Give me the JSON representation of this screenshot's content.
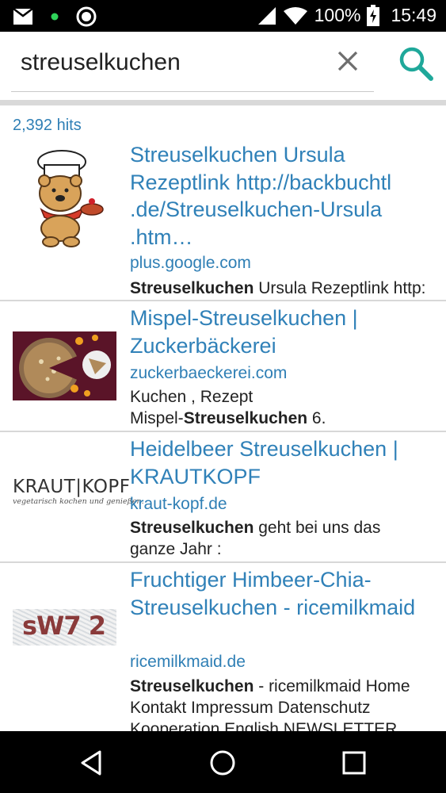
{
  "status_bar": {
    "battery_percent": "100%",
    "time": "15:49",
    "icons": [
      "mail-icon",
      "notification-dot-icon",
      "record-icon",
      "signal-icon",
      "wifi-icon",
      "battery-charging-icon"
    ]
  },
  "search": {
    "query": "streuselkuchen",
    "clear_icon": "close-icon",
    "search_icon": "search-icon"
  },
  "results_count": "2,392 hits",
  "results": [
    {
      "title": "Streuselkuchen Ursula Rezeptlink http://backbuchtl .de/Streuselkuchen-Ursula .htm…",
      "domain": "plus.google.com",
      "snippet_lines": [
        {
          "bold": "Streuselkuchen",
          "text": " Ursula Rezeptlink http:"
        }
      ],
      "thumbnail": "baker-teddy-bear-image"
    },
    {
      "title": "Mispel-Streuselkuchen | Zuckerbäckerei",
      "domain": "zuckerbaeckerei.com",
      "snippet_lines": [
        {
          "pre": "Kuchen , Rezept",
          "bold": "",
          "text": ""
        },
        {
          "pre": "Mispel-",
          "bold": "Streuselkuchen",
          "text": " 6."
        }
      ],
      "thumbnail": "streusel-cake-photo"
    },
    {
      "title": "Heidelbeer Streuselkuchen | KRAUTKOPF",
      "domain": "kraut-kopf.de",
      "snippet_lines": [
        {
          "bold": "Streuselkuchen",
          "text": " geht bei uns das"
        },
        {
          "pre": "ganze Jahr :",
          "bold": "",
          "text": ""
        }
      ],
      "thumbnail": "krautkopf-logo",
      "thumbnail_logo_text": "KRAUT|KOPF",
      "thumbnail_logo_sub": "vegetarisch kochen und genießen."
    },
    {
      "title": "Fruchtiger Himbeer-Chia-Streuselkuchen - ricemilkmaid",
      "domain": "ricemilkmaid.de",
      "snippet_lines": [
        {
          "bold": "Streuselkuchen",
          "text": " - ricemilkmaid Home"
        },
        {
          "pre": "Kontakt Impressum Datenschutz",
          "bold": "",
          "text": ""
        },
        {
          "pre": "Kooperation English NEWSLETTER",
          "bold": "",
          "text": ""
        }
      ],
      "thumbnail": "captcha-image",
      "thumbnail_captcha_text": "sW7 2"
    }
  ],
  "nav_bar": {
    "buttons": [
      "back-icon",
      "home-icon",
      "recents-icon"
    ]
  },
  "colors": {
    "link": "#3081b8",
    "accent": "#1fa89a",
    "divider": "#d8d8d8"
  }
}
